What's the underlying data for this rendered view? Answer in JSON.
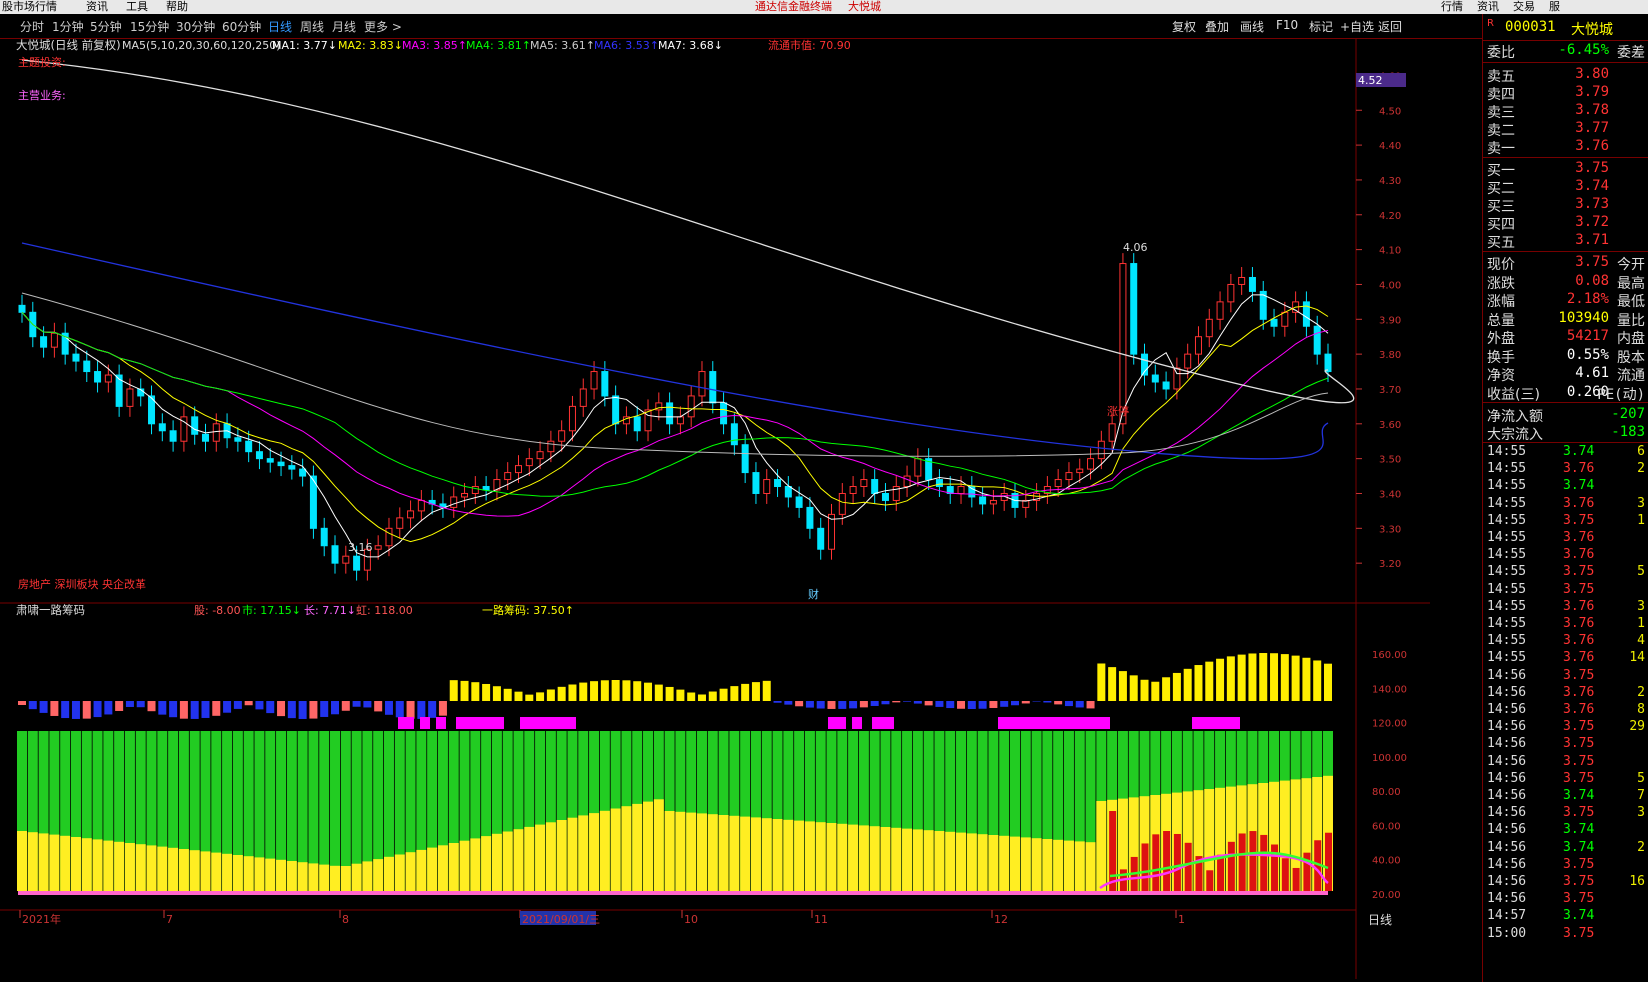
{
  "menubar": {
    "items": [
      "股市场行情",
      "资讯",
      "工具",
      "帮助"
    ],
    "center_items": [
      "通达信金融终端",
      "大悦城"
    ],
    "right_items": [
      "行情",
      "资讯",
      "交易",
      "服"
    ]
  },
  "toolbar": {
    "periods": [
      "分时",
      "1分钟",
      "5分钟",
      "15分钟",
      "30分钟",
      "60分钟",
      "日线",
      "周线",
      "月线",
      "更多 >"
    ],
    "active_period": "日线",
    "actions": [
      "复权",
      "叠加",
      "画线",
      "F10",
      "标记",
      "+自选",
      "返回"
    ]
  },
  "stock": {
    "code": "000031",
    "name": "大悦城",
    "code_prefix": "R"
  },
  "main_legend": {
    "title": "大悦城(日线 前复权)",
    "ma_params": "MA5(5,10,20,30,60,120,250)",
    "mas": [
      {
        "label": "MA1: 3.77↓",
        "color": "#ffffff"
      },
      {
        "label": "MA2: 3.83↓",
        "color": "#ffff00"
      },
      {
        "label": "MA3: 3.85↑",
        "color": "#ff00ff"
      },
      {
        "label": "MA4: 3.81↑",
        "color": "#00ff00"
      },
      {
        "label": "MA5: 3.61↑",
        "color": "#cccccc"
      },
      {
        "label": "MA6: 3.53↑",
        "color": "#3333ff"
      },
      {
        "label": "MA7: 3.68↓",
        "color": "#ffffff"
      }
    ],
    "market_cap": "流通市值: 70.90"
  },
  "annotations": {
    "top_left_1": "主题投资:",
    "top_left_2": "主营业务:",
    "bottom_left": "房地产 深圳板块 央企改革",
    "high_label": "4.06",
    "low_label": "3.16",
    "limit_label": "涨停",
    "fin_label": "财",
    "price_badge": "4.52"
  },
  "price_axis": {
    "labels": [
      "4.60",
      "4.50",
      "4.40",
      "4.30",
      "4.20",
      "4.10",
      "4.00",
      "3.90",
      "3.80",
      "3.70",
      "3.60",
      "3.50",
      "3.40",
      "3.30",
      "3.20"
    ],
    "min": 3.1,
    "max": 4.65
  },
  "sub_legend": {
    "title": "肃啸一路筹码",
    "items": [
      {
        "label": "股: -8.00",
        "color": "#ff5555"
      },
      {
        "label": "市: 17.15↓",
        "color": "#00ff00"
      },
      {
        "label": "长: 7.71↓",
        "color": "#ff66ff"
      },
      {
        "label": "虹: 118.00",
        "color": "#ff5555"
      },
      {
        "label": "一路筹码: 37.50↑",
        "color": "#ffff00"
      }
    ]
  },
  "sub_axis": {
    "labels": [
      "160.00",
      "140.00",
      "120.00",
      "100.00",
      "80.00",
      "60.00",
      "40.00",
      "20.00"
    ]
  },
  "time_axis": {
    "labels": [
      "2021年",
      "7",
      "8",
      "2021/09/01/三",
      "10",
      "11",
      "12",
      "1"
    ],
    "right_label": "日线"
  },
  "quote": {
    "委比": {
      "label": "委比",
      "value": "-6.45%",
      "extra_label": "委差"
    },
    "asks": [
      {
        "label": "卖五",
        "price": "3.80"
      },
      {
        "label": "卖四",
        "price": "3.79"
      },
      {
        "label": "卖三",
        "price": "3.78"
      },
      {
        "label": "卖二",
        "price": "3.77"
      },
      {
        "label": "卖一",
        "price": "3.76"
      }
    ],
    "bids": [
      {
        "label": "买一",
        "price": "3.75"
      },
      {
        "label": "买二",
        "price": "3.74"
      },
      {
        "label": "买三",
        "price": "3.73"
      },
      {
        "label": "买四",
        "price": "3.72"
      },
      {
        "label": "买五",
        "price": "3.71"
      }
    ],
    "stats": [
      {
        "l": "现价",
        "v": "3.75",
        "c": "#ff3333",
        "r": "今开"
      },
      {
        "l": "涨跌",
        "v": "0.08",
        "c": "#ff3333",
        "r": "最高"
      },
      {
        "l": "涨幅",
        "v": "2.18%",
        "c": "#ff3333",
        "r": "最低"
      },
      {
        "l": "总量",
        "v": "103940",
        "c": "#ffff00",
        "r": "量比"
      },
      {
        "l": "外盘",
        "v": "54217",
        "c": "#ff3333",
        "r": "内盘"
      },
      {
        "l": "换手",
        "v": "0.55%",
        "c": "#ffffff",
        "r": "股本"
      },
      {
        "l": "净资",
        "v": "4.61",
        "c": "#ffffff",
        "r": "流通"
      },
      {
        "l": "收益(三)",
        "v": "0.260",
        "c": "#ffffff",
        "r": "PE(动)"
      }
    ],
    "flows": [
      {
        "l": "净流入额",
        "v": "-207"
      },
      {
        "l": "大宗流入",
        "v": "-183"
      }
    ]
  },
  "ticks": [
    {
      "t": "14:55",
      "p": "3.74",
      "v": "6",
      "c": "#00ff00"
    },
    {
      "t": "14:55",
      "p": "3.76",
      "v": "2",
      "c": "#ff3333"
    },
    {
      "t": "14:55",
      "p": "3.74",
      "v": "",
      "c": "#00ff00"
    },
    {
      "t": "14:55",
      "p": "3.76",
      "v": "3",
      "c": "#ff3333"
    },
    {
      "t": "14:55",
      "p": "3.75",
      "v": "1",
      "c": "#ff3333"
    },
    {
      "t": "14:55",
      "p": "3.76",
      "v": "",
      "c": "#ff3333"
    },
    {
      "t": "14:55",
      "p": "3.76",
      "v": "",
      "c": "#ff3333"
    },
    {
      "t": "14:55",
      "p": "3.75",
      "v": "5",
      "c": "#ff3333"
    },
    {
      "t": "14:55",
      "p": "3.75",
      "v": "",
      "c": "#ff3333"
    },
    {
      "t": "14:55",
      "p": "3.76",
      "v": "3",
      "c": "#ff3333"
    },
    {
      "t": "14:55",
      "p": "3.76",
      "v": "1",
      "c": "#ff3333"
    },
    {
      "t": "14:55",
      "p": "3.76",
      "v": "4",
      "c": "#ff3333"
    },
    {
      "t": "14:55",
      "p": "3.76",
      "v": "14",
      "c": "#ff3333"
    },
    {
      "t": "14:56",
      "p": "3.75",
      "v": "",
      "c": "#ff3333"
    },
    {
      "t": "14:56",
      "p": "3.76",
      "v": "2",
      "c": "#ff3333"
    },
    {
      "t": "14:56",
      "p": "3.76",
      "v": "8",
      "c": "#ff3333"
    },
    {
      "t": "14:56",
      "p": "3.75",
      "v": "29",
      "c": "#ff3333"
    },
    {
      "t": "14:56",
      "p": "3.75",
      "v": "",
      "c": "#ff3333"
    },
    {
      "t": "14:56",
      "p": "3.75",
      "v": "",
      "c": "#ff3333"
    },
    {
      "t": "14:56",
      "p": "3.75",
      "v": "5",
      "c": "#ff3333"
    },
    {
      "t": "14:56",
      "p": "3.74",
      "v": "7",
      "c": "#00ff00"
    },
    {
      "t": "14:56",
      "p": "3.75",
      "v": "3",
      "c": "#ff3333"
    },
    {
      "t": "14:56",
      "p": "3.74",
      "v": "",
      "c": "#00ff00"
    },
    {
      "t": "14:56",
      "p": "3.74",
      "v": "2",
      "c": "#00ff00"
    },
    {
      "t": "14:56",
      "p": "3.75",
      "v": "",
      "c": "#ff3333"
    },
    {
      "t": "14:56",
      "p": "3.75",
      "v": "16",
      "c": "#ff3333"
    },
    {
      "t": "14:56",
      "p": "3.75",
      "v": "",
      "c": "#ff3333"
    },
    {
      "t": "14:57",
      "p": "3.74",
      "v": "",
      "c": "#00ff00"
    },
    {
      "t": "15:00",
      "p": "3.75",
      "v": "",
      "c": "#ff3333"
    }
  ],
  "chart_data": {
    "type": "candlestick",
    "period": "daily",
    "closes": [
      3.92,
      3.85,
      3.82,
      3.86,
      3.8,
      3.78,
      3.75,
      3.72,
      3.74,
      3.65,
      3.7,
      3.68,
      3.6,
      3.58,
      3.55,
      3.62,
      3.57,
      3.55,
      3.6,
      3.56,
      3.55,
      3.52,
      3.5,
      3.49,
      3.48,
      3.47,
      3.45,
      3.3,
      3.25,
      3.2,
      3.22,
      3.18,
      3.24,
      3.25,
      3.3,
      3.33,
      3.35,
      3.38,
      3.37,
      3.36,
      3.39,
      3.4,
      3.42,
      3.41,
      3.44,
      3.46,
      3.48,
      3.5,
      3.52,
      3.55,
      3.58,
      3.65,
      3.7,
      3.75,
      3.68,
      3.6,
      3.62,
      3.58,
      3.64,
      3.66,
      3.6,
      3.62,
      3.68,
      3.75,
      3.66,
      3.6,
      3.54,
      3.46,
      3.4,
      3.44,
      3.42,
      3.39,
      3.36,
      3.3,
      3.24,
      3.34,
      3.4,
      3.42,
      3.44,
      3.4,
      3.38,
      3.42,
      3.45,
      3.5,
      3.44,
      3.42,
      3.4,
      3.42,
      3.39,
      3.37,
      3.38,
      3.4,
      3.36,
      3.38,
      3.4,
      3.42,
      3.44,
      3.46,
      3.47,
      3.5,
      3.55,
      3.6,
      4.06,
      3.8,
      3.74,
      3.72,
      3.7,
      3.76,
      3.8,
      3.85,
      3.9,
      3.95,
      4.0,
      4.02,
      3.98,
      3.9,
      3.88,
      3.92,
      3.95,
      3.88,
      3.8,
      3.75
    ],
    "high_marker": 4.06,
    "low_marker": 3.16
  }
}
